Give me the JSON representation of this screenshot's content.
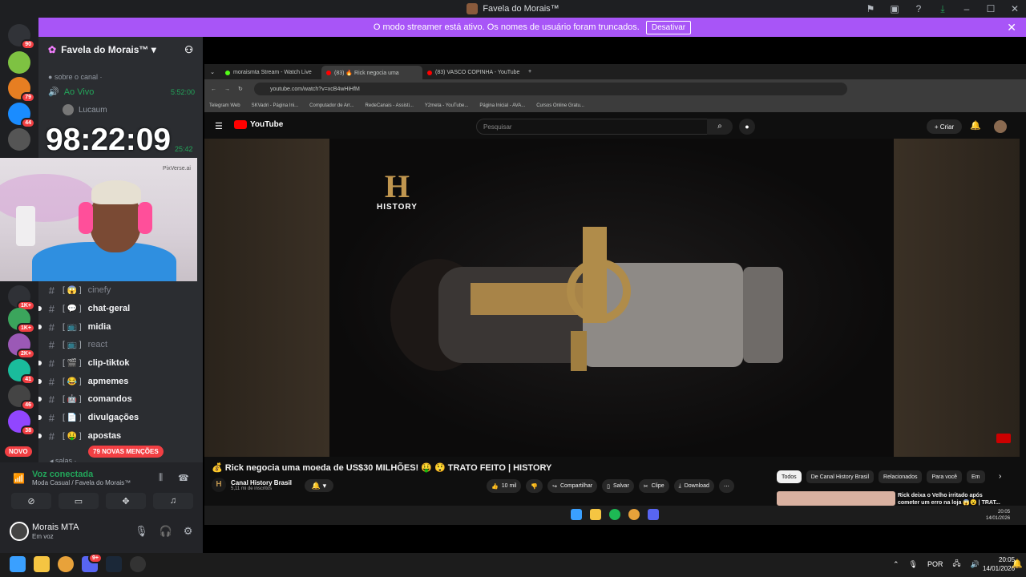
{
  "window": {
    "title": "Favela do Morais™"
  },
  "streamer_banner": {
    "text": "O modo streamer está ativo. Os nomes de usuário foram truncados.",
    "button": "Desativar"
  },
  "servers": [
    {
      "name": "home",
      "badge": "90",
      "color": "#5865f2"
    },
    {
      "name": "server-1",
      "badge": "",
      "color": "#3ba55c"
    },
    {
      "name": "server-2",
      "badge": "79",
      "color": "#e67e22"
    },
    {
      "name": "server-3",
      "badge": "44",
      "color": "#1a8cff"
    },
    {
      "name": "server-4",
      "badge": "",
      "color": "#555"
    },
    {
      "name": "server-5",
      "badge": "1K+",
      "color": "#2f3136"
    },
    {
      "name": "server-6",
      "badge": "1K+",
      "color": "#3ba55c"
    },
    {
      "name": "server-7",
      "badge": "2K+",
      "color": "#9b59b6"
    },
    {
      "name": "server-8",
      "badge": "41",
      "color": "#1abc9c"
    },
    {
      "name": "server-9",
      "badge": "46",
      "color": "#444"
    },
    {
      "name": "server-10",
      "badge": "38",
      "color": "#9146ff"
    }
  ],
  "novo_label": "NOVO",
  "guild": {
    "name": "Favela do Morais™"
  },
  "categories": {
    "sobre": "sobre o canal ·",
    "salas": "salas ·"
  },
  "voice_channel": {
    "name": "Ao Vivo",
    "time": "5:52:00",
    "time2": "25:42"
  },
  "members": [
    {
      "name": "Lucaum"
    }
  ],
  "timer": "98:22:09",
  "cam_label": "PixVerse.ai",
  "channels": [
    {
      "name": "cinefy",
      "emoji": "😱",
      "unread": false
    },
    {
      "name": "chat-geral",
      "emoji": "💬",
      "unread": true
    },
    {
      "name": "midia",
      "emoji": "📺",
      "unread": true
    },
    {
      "name": "react",
      "emoji": "📺",
      "unread": false
    },
    {
      "name": "clip-tiktok",
      "emoji": "🎬",
      "unread": true
    },
    {
      "name": "apmemes",
      "emoji": "😂",
      "unread": true
    },
    {
      "name": "comandos",
      "emoji": "🤖",
      "unread": true
    },
    {
      "name": "divulgações",
      "emoji": "📄",
      "unread": true
    },
    {
      "name": "apostas",
      "emoji": "🤑",
      "unread": true
    }
  ],
  "new_mentions": "79 NOVAS MENÇÕES",
  "voice_status": {
    "title": "Voz conectada",
    "subtitle": "Moda Casual / Favela do Morais™"
  },
  "user": {
    "name": "Morais MTA",
    "status": "Em voz"
  },
  "browser": {
    "tabs": [
      {
        "title": "moraismta Stream - Watch Live",
        "color": "#53fc18"
      },
      {
        "title": "(83) 🔥 Rick negocia uma",
        "color": "#ff0000"
      },
      {
        "title": "(83) VASCO COPINHA - YouTube",
        "color": "#ff0000"
      }
    ],
    "url": "youtube.com/watch?v=xcB4wHiHfM",
    "bookmarks": [
      "Telegram Web",
      "SKVadri - Página Ini...",
      "Computador de Arr...",
      "RedeCanais - Assisti...",
      "Y2meta - YouTube...",
      "Página Inicial - AVA...",
      "Cursos Online Gratu..."
    ]
  },
  "youtube": {
    "logo": "YouTube",
    "search_placeholder": "Pesquisar",
    "create": "Criar",
    "notif_badge": "9+",
    "history_logo": "HISTORY",
    "video_title": "💰 Rick negocia uma moeda de US$30 MILHÕES! 🤑 😲 TRATO FEITO | HISTORY",
    "channel_name": "Canal History Brasil",
    "subscribers": "5,11 mi de inscritos",
    "likes": "10 mil",
    "share": "Compartilhar",
    "save": "Salvar",
    "clip": "Clipe",
    "download": "Download",
    "chips": [
      "Todos",
      "De Canal History Brasil",
      "Relacionados",
      "Para você",
      "Em"
    ],
    "rec_title": "Rick deixa o Velho irritado após cometer um erro na loja 😱😮 | TRAT..."
  },
  "inner_clock": {
    "time": "20:05",
    "date": "14/01/2026"
  },
  "taskbar": {
    "lang": "POR",
    "time": "20:05",
    "date": "14/01/2026",
    "discord_badge": "9+"
  }
}
